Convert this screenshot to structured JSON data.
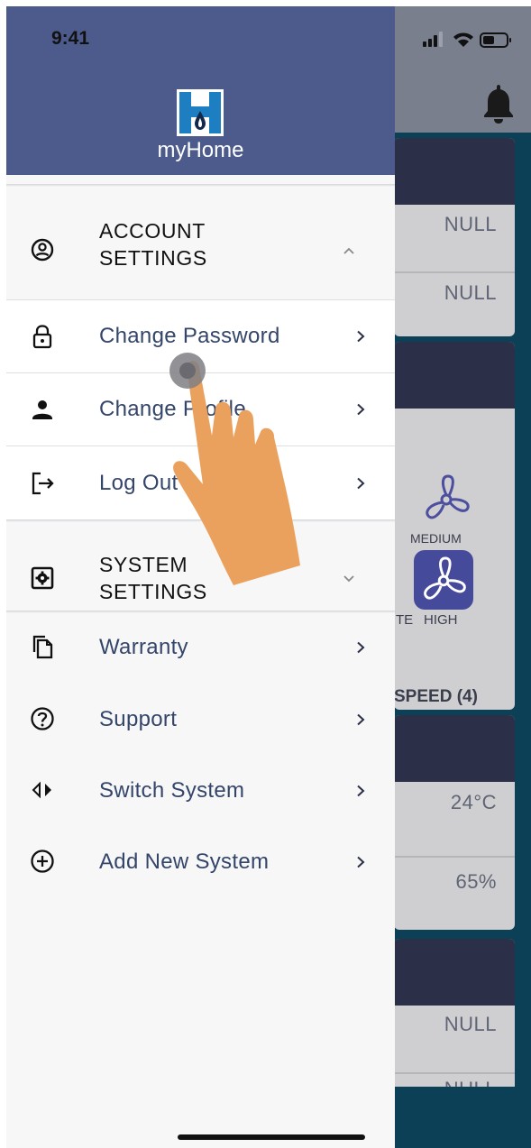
{
  "status_bar": {
    "time": "9:41"
  },
  "drawer": {
    "brand": "myHome",
    "account_settings": {
      "title_line1": "ACCOUNT",
      "title_line2": "SETTINGS",
      "items": [
        {
          "label": "Change Password",
          "icon": "lock-icon"
        },
        {
          "label": "Change Profile",
          "icon": "person-icon"
        },
        {
          "label": "Log Out",
          "icon": "logout-icon"
        }
      ]
    },
    "system_settings": {
      "title_line1": "SYSTEM",
      "title_line2": "SETTINGS",
      "items": [
        {
          "label": "Warranty",
          "icon": "copy-icon"
        },
        {
          "label": "Support",
          "icon": "help-icon"
        },
        {
          "label": "Switch System",
          "icon": "switch-icon"
        },
        {
          "label": "Add New System",
          "icon": "add-circle-icon"
        }
      ]
    }
  },
  "background": {
    "values": [
      "NULL",
      "NULL",
      "24°C",
      "65%",
      "NULL",
      "NULL"
    ],
    "fan_medium": "MEDIUM",
    "fan_labels": [
      "TE",
      "HIGH"
    ],
    "speed": "SPEED (4)"
  },
  "colors": {
    "drawer_header": "#4c5b8b",
    "label": "#34456a",
    "background_teal": "#0b4057",
    "fan_accent": "#4b4f9e",
    "hand": "#eaa15d"
  }
}
